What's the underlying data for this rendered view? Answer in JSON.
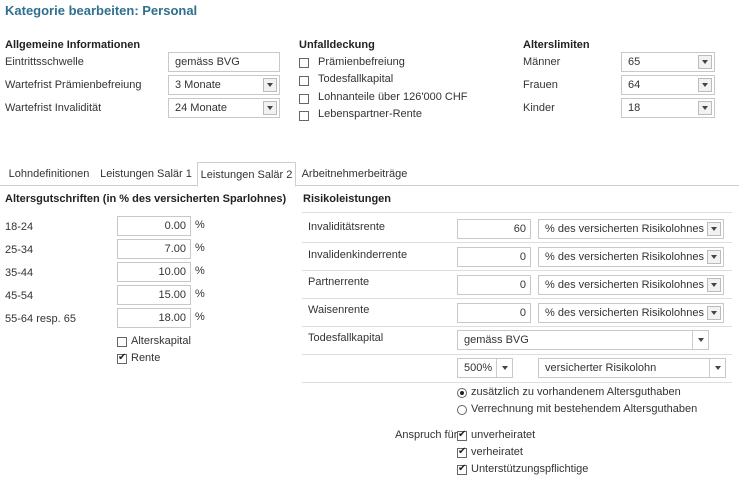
{
  "page_title": "Kategorie bearbeiten: Personal",
  "allgemein": {
    "heading": "Allgemeine Informationen",
    "rows": [
      {
        "label": "Eintrittsschwelle",
        "value": "gemäss BVG"
      },
      {
        "label": "Wartefrist Prämienbefreiung",
        "value": "3 Monate"
      },
      {
        "label": "Wartefrist Invalidität",
        "value": "24 Monate"
      }
    ]
  },
  "unfall": {
    "heading": "Unfalldeckung",
    "items": [
      {
        "label": "Prämienbefreiung",
        "checked": false
      },
      {
        "label": "Todesfallkapital",
        "checked": false
      },
      {
        "label": "Lohnanteile über 126'000 CHF",
        "checked": false
      },
      {
        "label": "Lebenspartner-Rente",
        "checked": false
      }
    ]
  },
  "alter": {
    "heading": "Alterslimiten",
    "rows": [
      {
        "label": "Männer",
        "value": "65"
      },
      {
        "label": "Frauen",
        "value": "64"
      },
      {
        "label": "Kinder",
        "value": "18"
      }
    ]
  },
  "tabs": [
    {
      "label": "Lohndefinitionen"
    },
    {
      "label": "Leistungen Salär 1"
    },
    {
      "label": "Leistungen Salär 2",
      "active": true
    },
    {
      "label": "Arbeitnehmerbeiträge"
    }
  ],
  "gutschriften": {
    "heading": "Altersgutschriften (in % des versicherten Sparlohnes)",
    "unit": "%",
    "rows": [
      {
        "label": "18-24",
        "value": "0.00"
      },
      {
        "label": "25-34",
        "value": "7.00"
      },
      {
        "label": "35-44",
        "value": "10.00"
      },
      {
        "label": "45-54",
        "value": "15.00"
      },
      {
        "label": "55-64 resp. 65",
        "value": "18.00"
      }
    ],
    "options": [
      {
        "label": "Alterskapital",
        "checked": false
      },
      {
        "label": "Rente",
        "checked": true
      }
    ]
  },
  "risiko": {
    "heading": "Risikoleistungen",
    "rows": [
      {
        "label": "Invaliditätsrente",
        "value": "60",
        "basis": "% des versicherten Risikolohnes"
      },
      {
        "label": "Invalidenkinderrente",
        "value": "0",
        "basis": "% des versicherten Risikolohnes"
      },
      {
        "label": "Partnerrente",
        "value": "0",
        "basis": "% des versicherten Risikolohnes"
      },
      {
        "label": "Waisenrente",
        "value": "0",
        "basis": "% des versicherten Risikolohnes"
      }
    ],
    "todesfall": {
      "label": "Todesfallkapital",
      "type": "gemäss BVG",
      "factor": "500%",
      "basis": "versicherter Risikolohn"
    },
    "radios": [
      {
        "label": "zusätzlich zu vorhandenem Altersguthaben",
        "selected": true
      },
      {
        "label": "Verrechnung mit bestehendem Altersguthaben",
        "selected": false
      }
    ],
    "anspruch_label": "Anspruch für",
    "anspruch": [
      {
        "label": "unverheiratet",
        "checked": true
      },
      {
        "label": "verheiratet",
        "checked": true
      },
      {
        "label": "Unterstützungspflichtige",
        "checked": true
      }
    ]
  },
  "colors": {
    "title": "#2f6f8f",
    "border": "#c8c8c8"
  }
}
